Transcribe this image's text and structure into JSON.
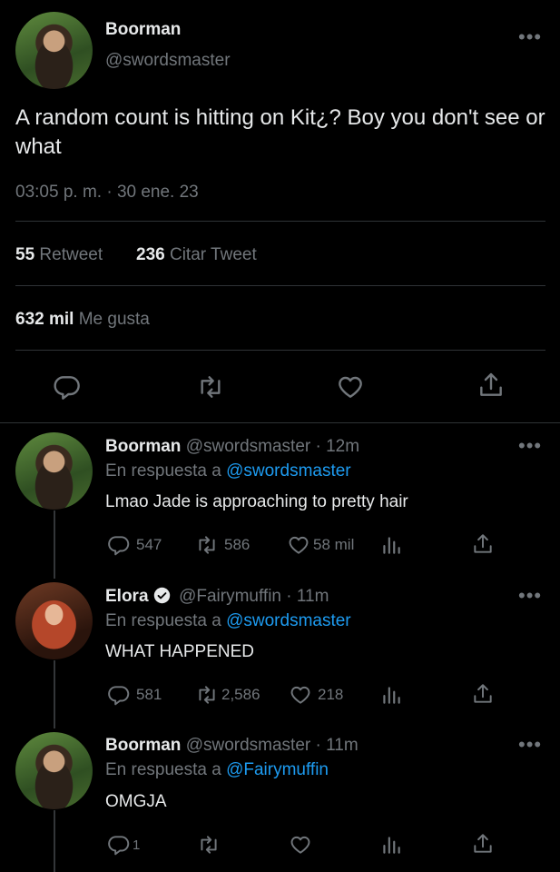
{
  "main_tweet": {
    "name": "Boorman",
    "handle": "@swordsmaster",
    "text": "A random count is hitting on Kit¿? Boy you don't see or what",
    "timestamp": "03:05 p. m. · 30 ene. 23",
    "retweets": "55",
    "retweets_label": "Retweet",
    "quotes": "236",
    "quotes_label": "Citar Tweet",
    "likes": "632 mil",
    "likes_label": "Me gusta",
    "more": "•••"
  },
  "replies": [
    {
      "name": "Boorman",
      "handle_time": "@swordsmaster · 12m",
      "reply_prefix": "En respuesta a",
      "reply_to": "@swordsmaster",
      "text": "Lmao Jade is approaching to pretty hair",
      "comments": "547",
      "retweets": "586",
      "likes": "58 mil",
      "more": "•••"
    },
    {
      "name": "Elora",
      "handle_time": "@Fairymuffin · 11m",
      "reply_prefix": "En respuesta a",
      "reply_to": "@swordsmaster",
      "text": "WHAT HAPPENED",
      "comments": "581",
      "retweets": "2,586",
      "likes": "218",
      "more": "•••"
    },
    {
      "name": "Boorman",
      "handle_time": "@swordsmaster · 11m",
      "reply_prefix": "En respuesta a",
      "reply_to": "@Fairymuffin",
      "text": "OMGJA",
      "comments": "1",
      "retweets": "",
      "likes": "",
      "more": "•••"
    }
  ],
  "icons": [
    "reply-icon",
    "retweet-icon",
    "like-icon",
    "share-icon",
    "views-icon",
    "verified-icon",
    "more-icon"
  ],
  "colors": {
    "background": "#000000",
    "text": "#e7e9ea",
    "muted": "#71767b",
    "link": "#1d9bf0"
  }
}
